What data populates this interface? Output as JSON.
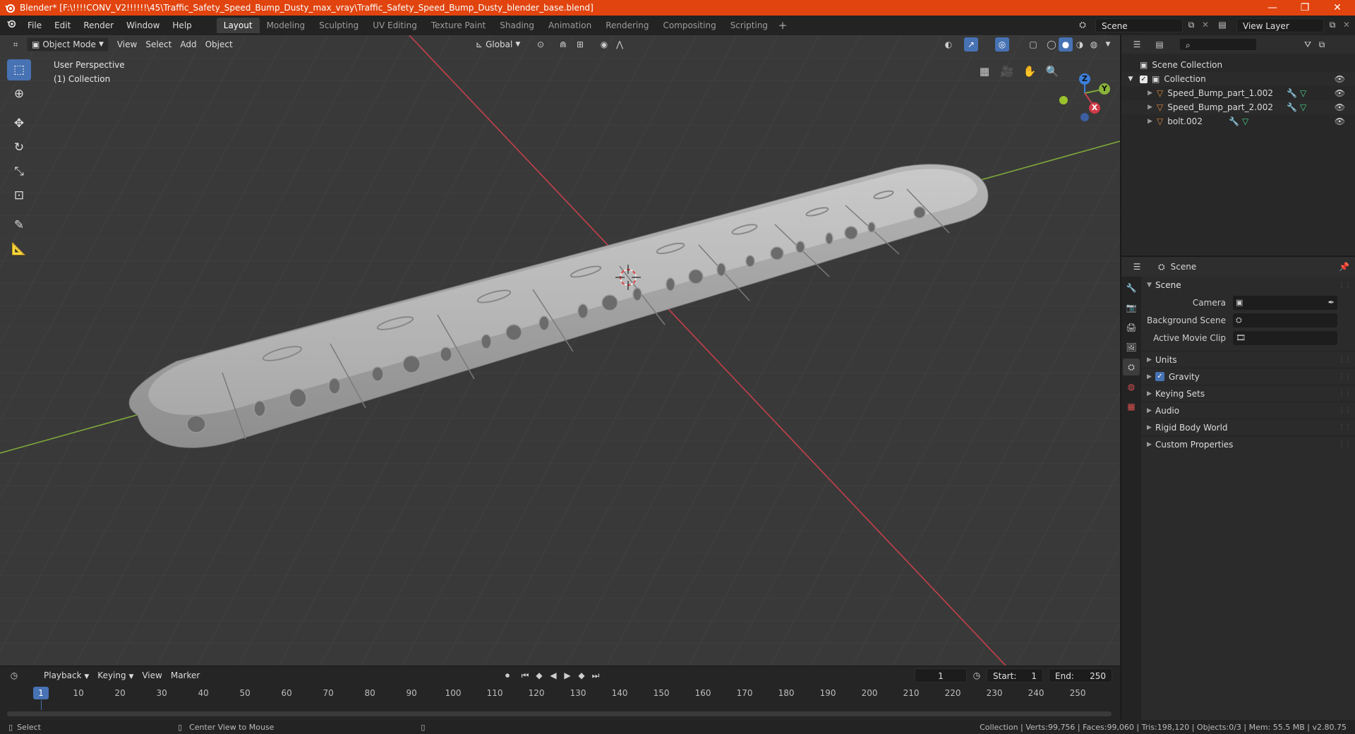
{
  "window": {
    "title": "Blender* [F:\\!!!!CONV_V2!!!!!!\\45\\Traffic_Safety_Speed_Bump_Dusty_max_vray\\Traffic_Safety_Speed_Bump_Dusty_blender_base.blend]",
    "minimize": "—",
    "restore": "❐",
    "close": "✕"
  },
  "menu": {
    "items": [
      "File",
      "Edit",
      "Render",
      "Window",
      "Help"
    ]
  },
  "workspaces": {
    "tabs": [
      "Layout",
      "Modeling",
      "Sculpting",
      "UV Editing",
      "Texture Paint",
      "Shading",
      "Animation",
      "Rendering",
      "Compositing",
      "Scripting"
    ],
    "active": "Layout",
    "add": "+"
  },
  "scene_selector": {
    "value": "Scene"
  },
  "view_layer_selector": {
    "value": "View Layer"
  },
  "viewport": {
    "mode": "Object Mode",
    "menus": [
      "View",
      "Select",
      "Add",
      "Object"
    ],
    "transform_orientation": "Global",
    "info_line1": "User Perspective",
    "info_line2": "(1) Collection",
    "axis_x": "X",
    "axis_y": "Y",
    "axis_z": "Z"
  },
  "outliner": {
    "root": "Scene Collection",
    "collection": "Collection",
    "objects": [
      "Speed_Bump_part_1.002",
      "Speed_Bump_part_2.002",
      "bolt.002"
    ]
  },
  "properties": {
    "header_title": "Scene",
    "panel": "Scene",
    "rows": [
      {
        "label": "Camera"
      },
      {
        "label": "Background Scene"
      },
      {
        "label": "Active Movie Clip"
      }
    ],
    "sub_panels": [
      "Units",
      "Gravity",
      "Keying Sets",
      "Audio",
      "Rigid Body World",
      "Custom Properties"
    ],
    "gravity_enabled": true
  },
  "timeline": {
    "menus": [
      "Playback",
      "Keying",
      "View",
      "Marker"
    ],
    "current_frame": "1",
    "start_label": "Start:",
    "start_value": "1",
    "end_label": "End:",
    "end_value": "250",
    "ticks": [
      10,
      20,
      30,
      40,
      50,
      60,
      70,
      80,
      90,
      100,
      110,
      120,
      130,
      140,
      150,
      160,
      170,
      180,
      190,
      200,
      210,
      220,
      230,
      240,
      250
    ],
    "cursor_label": "1"
  },
  "statusbar": {
    "left1": "Select",
    "left2": "Center View to Mouse",
    "stats": "Collection | Verts:99,756 | Faces:99,060 | Tris:198,120 | Objects:0/3 | Mem: 55.5 MB | v2.80.75"
  },
  "colors": {
    "title_bar": "#e1440f",
    "accent": "#4772b3",
    "viewport_bg": "#393939",
    "x_axis": "#c6404a",
    "y_axis": "#7fa83a",
    "z_axis": "#3b7fdb"
  }
}
